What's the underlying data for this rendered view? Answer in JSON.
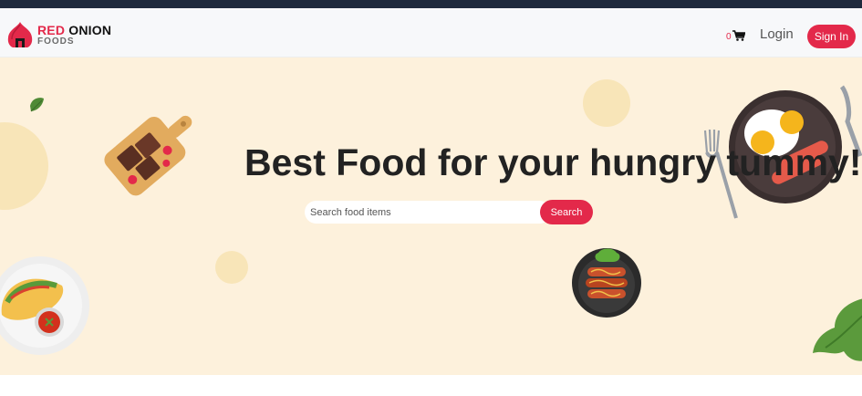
{
  "brand": {
    "name_part1": "RED",
    "name_part2": "ONION",
    "subtitle": "FOODS"
  },
  "nav": {
    "cart_count": "0",
    "login_label": "Login",
    "signin_label": "Sign In"
  },
  "hero": {
    "title": "Best Food for your hungry tummy!!",
    "search_placeholder": "Search food items",
    "search_button": "Search"
  },
  "colors": {
    "accent": "#e3294a",
    "hero_bg": "#fdf1dc"
  },
  "icons": [
    "onion-logo-icon",
    "cart-icon",
    "leaf-icon",
    "chocolate-board-icon",
    "fried-eggs-plate-icon",
    "fork-icon",
    "knife-icon",
    "taco-plate-icon",
    "sausage-bowl-icon",
    "lettuce-icon"
  ]
}
